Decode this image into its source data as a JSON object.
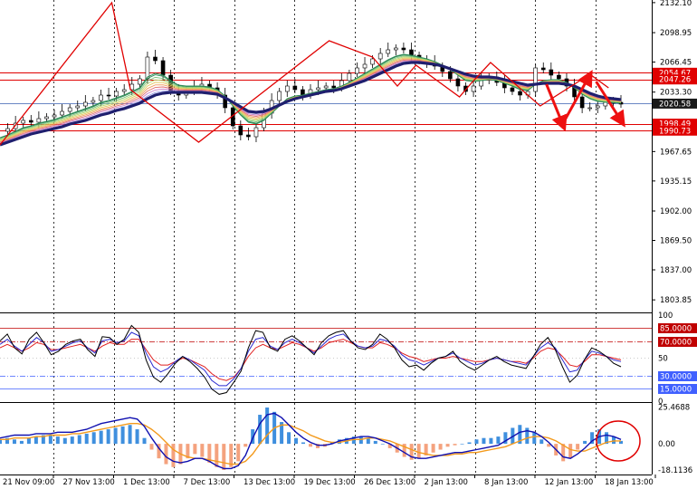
{
  "chart_data": {
    "type": "line",
    "price": {
      "y_ticks": [
        "2132.10",
        "2098.95",
        "2066.45",
        "2033.30",
        "1967.65",
        "1935.15",
        "1902.00",
        "1869.50",
        "1837.00",
        "1803.85"
      ],
      "ylim": [
        1790.0,
        2135.0
      ],
      "close": [
        1990,
        1993,
        1999,
        2002,
        2000,
        2004,
        2006,
        2008,
        2012,
        2016,
        2018,
        2022,
        2024,
        2030,
        2029,
        2034,
        2036,
        2042,
        2048,
        2072,
        2068,
        2052,
        2034,
        2030,
        2036,
        2040,
        2042,
        2038,
        2030,
        2016,
        1996,
        1986,
        1984,
        1994,
        2010,
        2024,
        2034,
        2040,
        2036,
        2030,
        2036,
        2038,
        2040,
        2038,
        2046,
        2054,
        2060,
        2064,
        2070,
        2076,
        2080,
        2082,
        2080,
        2074,
        2068,
        2066,
        2062,
        2056,
        2048,
        2040,
        2034,
        2040,
        2048,
        2050,
        2044,
        2038,
        2034,
        2030,
        2034,
        2060,
        2058,
        2052,
        2048,
        2040,
        2028,
        2016,
        2016,
        2018,
        2022,
        2022,
        2020
      ],
      "ribbon_fast": [
        1983,
        1986,
        1990,
        1994,
        1996,
        1999,
        2001,
        2003,
        2006,
        2009,
        2012,
        2015,
        2018,
        2022,
        2024,
        2027,
        2030,
        2034,
        2038,
        2050,
        2054,
        2052,
        2046,
        2041,
        2040,
        2040,
        2040,
        2039,
        2036,
        2029,
        2018,
        2008,
        2000,
        1998,
        2002,
        2010,
        2018,
        2026,
        2029,
        2030,
        2032,
        2034,
        2036,
        2037,
        2040,
        2044,
        2049,
        2054,
        2059,
        2064,
        2069,
        2073,
        2075,
        2074,
        2072,
        2070,
        2067,
        2063,
        2058,
        2052,
        2046,
        2045,
        2046,
        2047,
        2046,
        2043,
        2040,
        2036,
        2035,
        2042,
        2046,
        2047,
        2047,
        2044,
        2038,
        2031,
        2026,
        2023,
        2022,
        2022,
        2021
      ],
      "ema_slow": [
        1975,
        1978,
        1981,
        1984,
        1987,
        1989,
        1991,
        1993,
        1995,
        1998,
        2000,
        2002,
        2005,
        2008,
        2010,
        2013,
        2015,
        2018,
        2021,
        2026,
        2030,
        2032,
        2033,
        2033,
        2033,
        2033,
        2033,
        2032,
        2031,
        2027,
        2022,
        2017,
        2012,
        2011,
        2012,
        2015,
        2019,
        2023,
        2026,
        2028,
        2030,
        2032,
        2034,
        2035,
        2037,
        2040,
        2043,
        2046,
        2050,
        2054,
        2058,
        2062,
        2065,
        2066,
        2066,
        2065,
        2064,
        2062,
        2059,
        2056,
        2053,
        2051,
        2050,
        2050,
        2049,
        2047,
        2045,
        2043,
        2041,
        2042,
        2043,
        2043,
        2043,
        2042,
        2040,
        2036,
        2032,
        2029,
        2027,
        2026,
        2025
      ],
      "zigzag": [
        [
          0,
          1975
        ],
        [
          18,
          2132
        ],
        [
          21,
          2036
        ],
        [
          32,
          1978
        ],
        [
          53,
          2090
        ],
        [
          60,
          2072
        ],
        [
          64,
          2040
        ],
        [
          67,
          2063
        ],
        [
          74,
          2028
        ],
        [
          76,
          2044
        ],
        [
          79,
          2066
        ],
        [
          87,
          2018
        ],
        [
          95,
          2053
        ],
        [
          98,
          2038
        ]
      ],
      "levels": [
        2054.67,
        2047.26,
        1998.49,
        1990.73
      ],
      "current": 2020.58,
      "level_labels": [
        "2054.67",
        "2047.26",
        "1998.49",
        "1990.73"
      ],
      "current_label": "2020.58"
    },
    "oscillator": {
      "y_ticks": [
        "100",
        "50",
        "0"
      ],
      "ylim": [
        0,
        100
      ],
      "levels": [
        85,
        70,
        30,
        15
      ],
      "level_labels": [
        "85.0000",
        "70.0000",
        "30.0000",
        "15.0000"
      ],
      "black": [
        70,
        78,
        62,
        55,
        72,
        80,
        68,
        54,
        58,
        66,
        70,
        72,
        60,
        52,
        75,
        74,
        66,
        72,
        88,
        80,
        48,
        28,
        22,
        32,
        44,
        52,
        46,
        38,
        28,
        14,
        8,
        10,
        22,
        35,
        62,
        82,
        80,
        62,
        58,
        72,
        76,
        70,
        62,
        54,
        68,
        76,
        80,
        82,
        70,
        62,
        60,
        66,
        78,
        72,
        62,
        48,
        40,
        42,
        36,
        44,
        50,
        52,
        58,
        46,
        40,
        36,
        42,
        48,
        52,
        46,
        42,
        40,
        38,
        52,
        66,
        74,
        60,
        40,
        22,
        30,
        48,
        62,
        58,
        52,
        44,
        40
      ],
      "blue": [
        66,
        72,
        64,
        58,
        66,
        74,
        68,
        58,
        60,
        64,
        68,
        70,
        62,
        56,
        70,
        72,
        68,
        70,
        80,
        76,
        56,
        40,
        34,
        38,
        46,
        52,
        48,
        42,
        36,
        24,
        18,
        18,
        26,
        38,
        58,
        72,
        74,
        64,
        60,
        68,
        72,
        68,
        62,
        56,
        64,
        72,
        76,
        78,
        70,
        64,
        62,
        64,
        72,
        70,
        64,
        54,
        48,
        46,
        42,
        46,
        50,
        52,
        56,
        50,
        46,
        42,
        44,
        48,
        50,
        48,
        46,
        44,
        42,
        52,
        62,
        68,
        62,
        48,
        34,
        36,
        48,
        58,
        56,
        52,
        48,
        46
      ],
      "red": [
        62,
        66,
        62,
        58,
        62,
        68,
        66,
        60,
        60,
        62,
        64,
        66,
        62,
        58,
        64,
        68,
        66,
        66,
        72,
        72,
        60,
        48,
        42,
        42,
        46,
        50,
        48,
        44,
        40,
        32,
        26,
        24,
        28,
        38,
        52,
        62,
        66,
        62,
        60,
        64,
        68,
        66,
        62,
        58,
        62,
        68,
        70,
        72,
        68,
        64,
        62,
        62,
        68,
        66,
        62,
        56,
        52,
        50,
        46,
        48,
        50,
        50,
        52,
        50,
        48,
        46,
        46,
        48,
        50,
        48,
        46,
        46,
        44,
        50,
        58,
        62,
        60,
        52,
        42,
        40,
        46,
        54,
        54,
        52,
        50,
        48
      ]
    },
    "macd": {
      "y_ticks": [
        "25.4688",
        "0.00",
        "-18.1136"
      ],
      "ylim": [
        -20.5,
        27.5
      ],
      "histogram": [
        3,
        4,
        3,
        2,
        4,
        5,
        6,
        6,
        5,
        4,
        5,
        6,
        7,
        8,
        9,
        10,
        11,
        12,
        13,
        10,
        4,
        -4,
        -10,
        -14,
        -16,
        -14,
        -10,
        -7,
        -9,
        -13,
        -16,
        -18,
        -16,
        -12,
        -2,
        10,
        20,
        25,
        22,
        15,
        8,
        4,
        1,
        -2,
        -3,
        -2,
        1,
        3,
        4,
        5,
        5,
        4,
        2,
        0,
        -3,
        -6,
        -9,
        -11,
        -10,
        -8,
        -6,
        -4,
        -2,
        -1,
        0,
        1,
        3,
        4,
        4,
        5,
        8,
        11,
        13,
        11,
        8,
        3,
        -2,
        -8,
        -12,
        -10,
        -4,
        2,
        8,
        10,
        8,
        5,
        2
      ],
      "signal_blue": [
        4,
        5,
        6,
        6,
        6,
        7,
        7,
        7,
        8,
        8,
        8,
        9,
        10,
        12,
        14,
        15,
        16,
        17,
        18,
        17,
        12,
        4,
        -3,
        -9,
        -12,
        -13,
        -12,
        -10,
        -10,
        -12,
        -15,
        -17,
        -17,
        -15,
        -8,
        4,
        14,
        20,
        21,
        18,
        13,
        8,
        4,
        1,
        -1,
        -1,
        0,
        2,
        3,
        4,
        5,
        5,
        4,
        2,
        0,
        -3,
        -6,
        -9,
        -10,
        -10,
        -9,
        -8,
        -7,
        -6,
        -6,
        -5,
        -4,
        -3,
        -2,
        -1,
        2,
        5,
        8,
        9,
        8,
        5,
        1,
        -4,
        -9,
        -10,
        -7,
        -3,
        2,
        5,
        6,
        5,
        3
      ],
      "signal_orange": [
        3,
        3,
        4,
        4,
        4,
        5,
        5,
        6,
        6,
        6,
        7,
        7,
        8,
        9,
        10,
        11,
        12,
        13,
        14,
        14,
        13,
        10,
        6,
        1,
        -4,
        -7,
        -9,
        -10,
        -10,
        -11,
        -12,
        -13,
        -14,
        -14,
        -12,
        -7,
        0,
        6,
        11,
        13,
        13,
        11,
        9,
        6,
        4,
        2,
        1,
        1,
        2,
        3,
        3,
        4,
        4,
        3,
        2,
        0,
        -2,
        -4,
        -6,
        -7,
        -8,
        -8,
        -8,
        -7,
        -7,
        -6,
        -6,
        -5,
        -4,
        -3,
        -2,
        0,
        2,
        4,
        5,
        5,
        4,
        2,
        -1,
        -4,
        -5,
        -5,
        -3,
        -1,
        1,
        2,
        2
      ]
    },
    "x_ticks": [
      "21 Nov 09:00",
      "27 Nov 13:00",
      "1 Dec 13:00",
      "7 Dec 13:00",
      "13 Dec 13:00",
      "19 Dec 13:00",
      "26 Dec 13:00",
      "2 Jan 13:00",
      "8 Jan 13:00",
      "12 Jan 13:00",
      "18 Jan 13:00"
    ]
  },
  "colors": {
    "background": "#ffffff",
    "grid": "#000000",
    "level_red": "#e00000",
    "current_line": "#3a5fb0",
    "current_tag": "#1a1a1a",
    "ema": "#1f1f6e",
    "zigzag": "#e00000",
    "candles": "#000000",
    "arrows": "#ee1111",
    "hist_up": "#3f8fde",
    "hist_down": "#f4a27e",
    "macd_blue": "#1010b0",
    "macd_orange": "#f39a1c",
    "osc_red": "#e02020",
    "osc_blue": "#2a2ad0",
    "osc_black": "#000000",
    "osc_level_red": "#c00000",
    "osc_level_blue": "#4060ff",
    "circle": "#e00000",
    "ribbon": [
      "#2e8b57",
      "#7cc47a",
      "#b5d86f",
      "#e3c75a",
      "#f0a060",
      "#e07070",
      "#c97fc9",
      "#9a9ae6"
    ]
  }
}
